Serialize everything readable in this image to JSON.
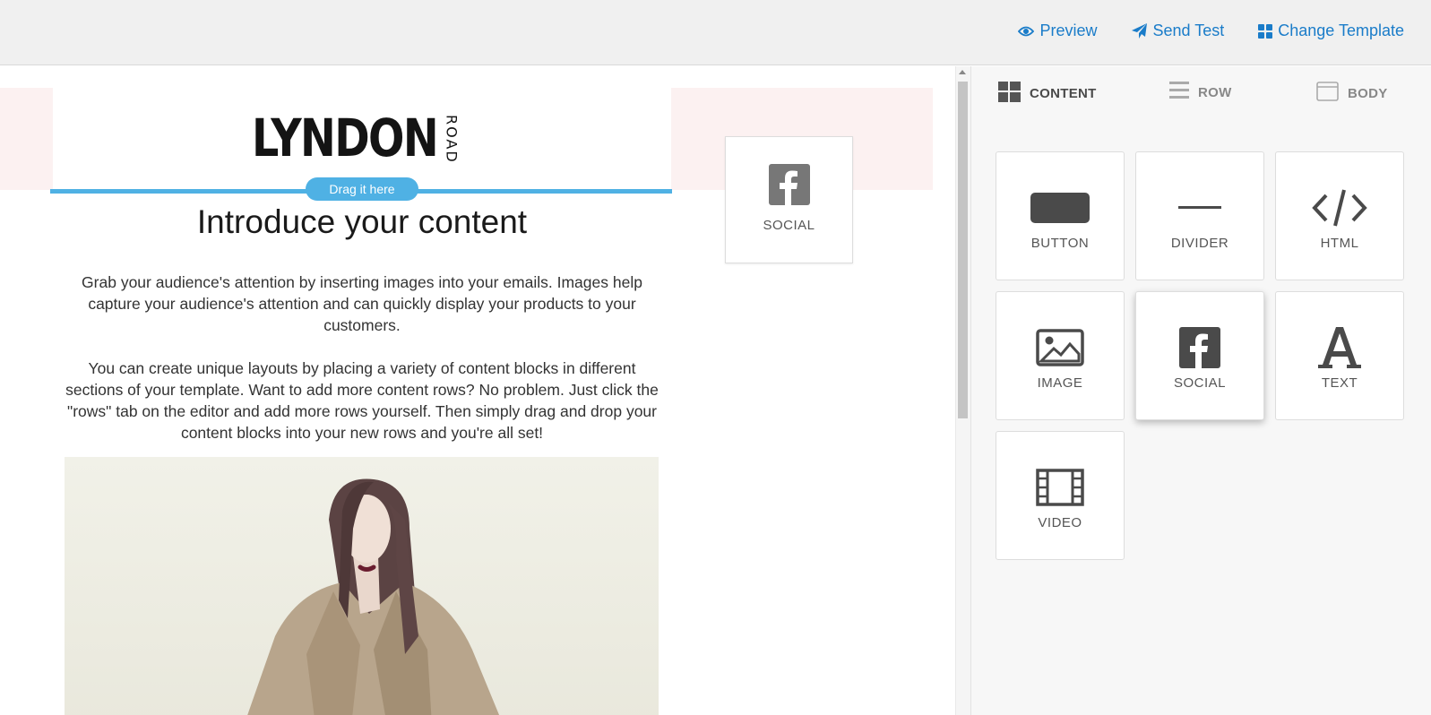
{
  "toolbar": {
    "preview_label": "Preview",
    "send_test_label": "Send Test",
    "change_template_label": "Change Template"
  },
  "email": {
    "logo_main": "LYNDON",
    "logo_sub": "ROAD",
    "drop_hint": "Drag it here",
    "heading": "Introduce your content",
    "paragraph_1": "Grab your audience's attention by inserting images into your emails. Images help capture your audience's attention and can quickly display your products to your customers.",
    "paragraph_2": "You can create unique layouts by placing a variety of content blocks in different sections of your template. Want to add more content rows? No problem. Just click the \"rows\" tab on the editor and add more rows yourself. Then simply drag and drop your content blocks into your new rows and you're all set!"
  },
  "dragged_block": {
    "label": "SOCIAL",
    "icon": "facebook-icon"
  },
  "panel": {
    "tabs": [
      {
        "label": "CONTENT",
        "icon": "grid-icon",
        "active": true
      },
      {
        "label": "ROW",
        "icon": "rows-icon",
        "active": false
      },
      {
        "label": "BODY",
        "icon": "window-icon",
        "active": false
      }
    ],
    "blocks": [
      {
        "label": "BUTTON",
        "icon": "button-icon"
      },
      {
        "label": "DIVIDER",
        "icon": "divider-icon"
      },
      {
        "label": "HTML",
        "icon": "code-icon"
      },
      {
        "label": "IMAGE",
        "icon": "image-icon"
      },
      {
        "label": "SOCIAL",
        "icon": "facebook-icon"
      },
      {
        "label": "TEXT",
        "icon": "text-icon"
      },
      {
        "label": "VIDEO",
        "icon": "film-icon"
      }
    ]
  },
  "colors": {
    "link_blue": "#1a7cc9",
    "drop_blue": "#4fb1e4",
    "icon_gray": "#4a4a4a"
  }
}
